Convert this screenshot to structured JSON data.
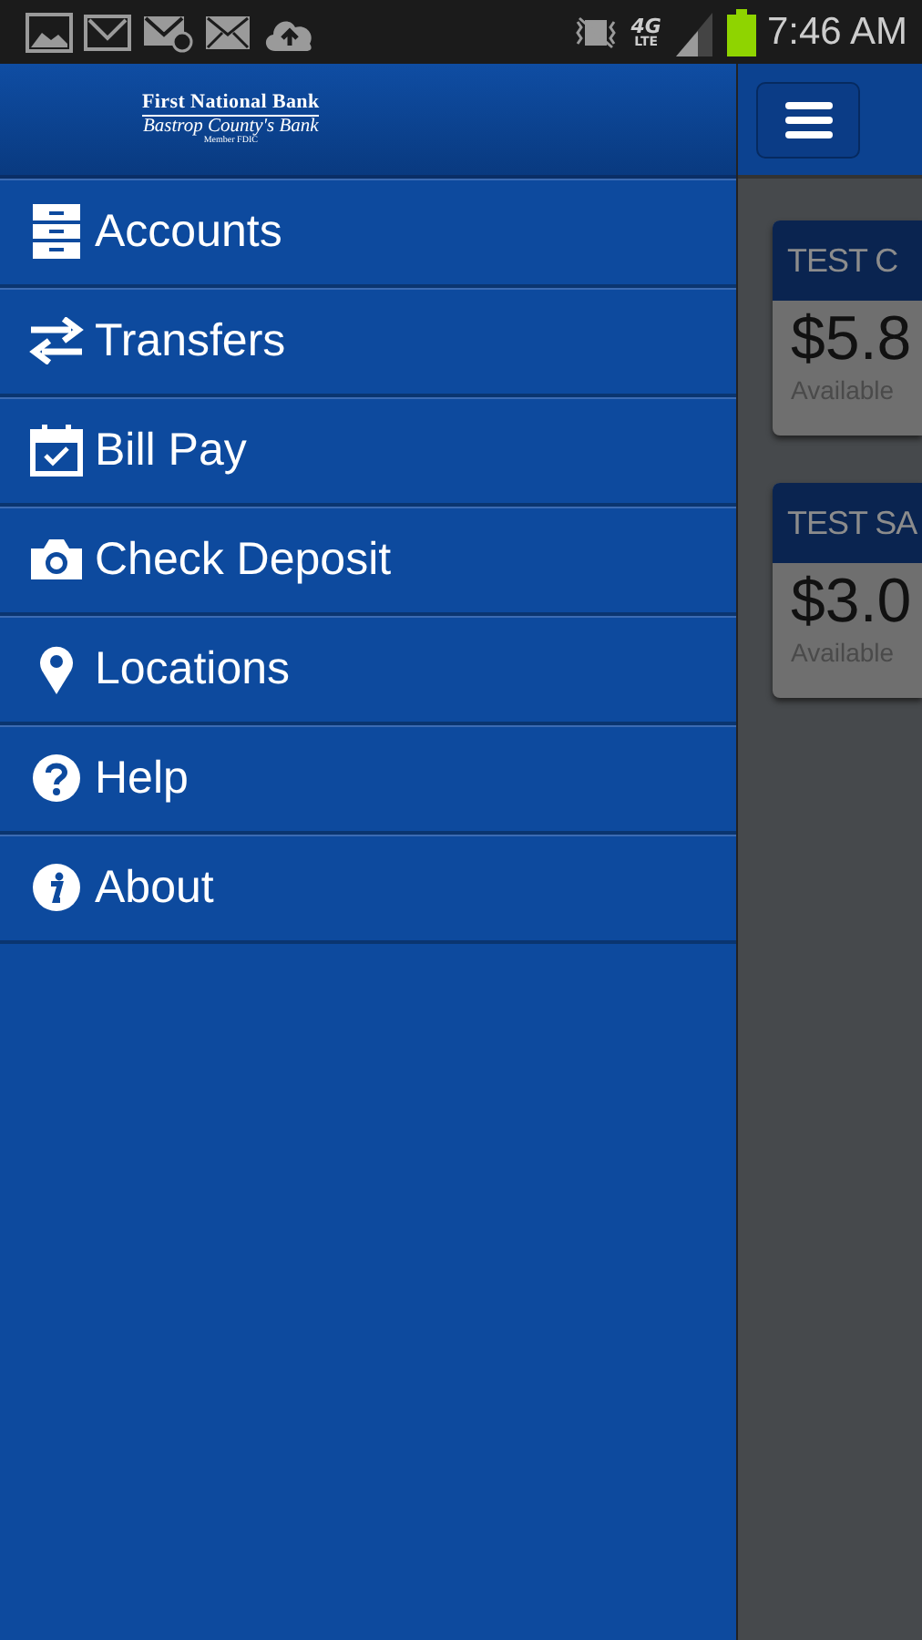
{
  "status_bar": {
    "network": {
      "generation": "4G",
      "tech": "LTE"
    },
    "time": "7:46 AM"
  },
  "drawer": {
    "logo": {
      "name": "First National Bank",
      "tagline": "Bastrop County's Bank",
      "note": "Member FDIC"
    },
    "items": [
      {
        "label": "Accounts"
      },
      {
        "label": "Transfers"
      },
      {
        "label": "Bill Pay"
      },
      {
        "label": "Check Deposit"
      },
      {
        "label": "Locations"
      },
      {
        "label": "Help"
      },
      {
        "label": "About"
      }
    ]
  },
  "accounts": [
    {
      "name": "TEST C",
      "balance": "$5.8",
      "caption": "Available"
    },
    {
      "name": "TEST SA",
      "balance": "$3.0",
      "caption": "Available"
    }
  ]
}
